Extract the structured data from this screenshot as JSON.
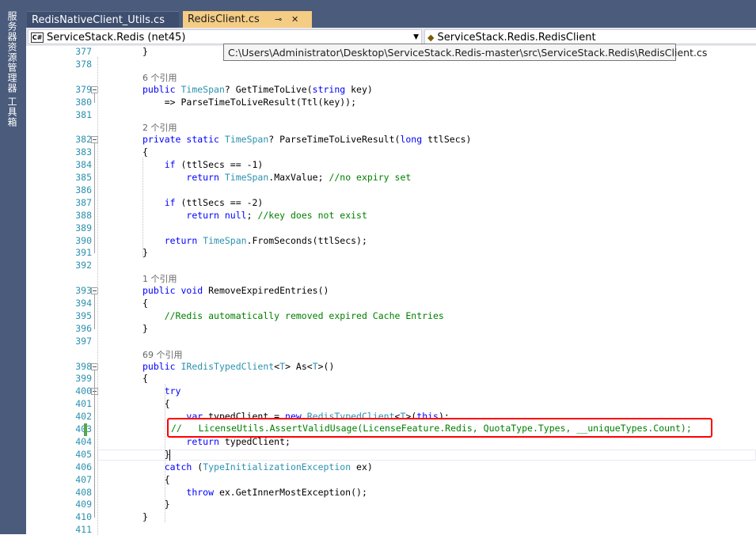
{
  "sidebar": {
    "items": [
      {
        "label": "服务器资源管理器"
      },
      {
        "label": "工具箱"
      }
    ]
  },
  "tabs": [
    {
      "label": "RedisNativeClient_Utils.cs",
      "active": false
    },
    {
      "label": "RedisClient.cs",
      "active": true
    }
  ],
  "tab_icons": {
    "pin": "⊸",
    "close": "✕"
  },
  "nav": {
    "project": "ServiceStack.Redis (net45)",
    "project_badge": "C#",
    "type": "ServiceStack.Redis.RedisClient",
    "dropdown_icon": "▼"
  },
  "tooltip": "C:\\Users\\Administrator\\Desktop\\ServiceStack.Redis-master\\src\\ServiceStack.Redis\\RedisClient.cs",
  "highlight_line": "//   LicenseUtils.AssertValidUsage(LicenseFeature.Redis, QuotaType.Types, __uniqueTypes.Count);",
  "lines": [
    {
      "n": "377",
      "code": "}"
    },
    {
      "n": "378",
      "code": ""
    },
    {
      "n": "",
      "code": "6 个引用"
    },
    {
      "n": "379",
      "code": "public TimeSpan? GetTimeToLive(string key)"
    },
    {
      "n": "380",
      "code": "    => ParseTimeToLiveResult(Ttl(key));"
    },
    {
      "n": "381",
      "code": ""
    },
    {
      "n": "",
      "code": "2 个引用"
    },
    {
      "n": "382",
      "code": "private static TimeSpan? ParseTimeToLiveResult(long ttlSecs)"
    },
    {
      "n": "383",
      "code": "{"
    },
    {
      "n": "384",
      "code": "    if (ttlSecs == -1)"
    },
    {
      "n": "385",
      "code": "        return TimeSpan.MaxValue; //no expiry set"
    },
    {
      "n": "386",
      "code": ""
    },
    {
      "n": "387",
      "code": "    if (ttlSecs == -2)"
    },
    {
      "n": "388",
      "code": "        return null; //key does not exist"
    },
    {
      "n": "389",
      "code": ""
    },
    {
      "n": "390",
      "code": "    return TimeSpan.FromSeconds(ttlSecs);"
    },
    {
      "n": "391",
      "code": "}"
    },
    {
      "n": "392",
      "code": ""
    },
    {
      "n": "",
      "code": "1 个引用"
    },
    {
      "n": "393",
      "code": "public void RemoveExpiredEntries()"
    },
    {
      "n": "394",
      "code": "{"
    },
    {
      "n": "395",
      "code": "    //Redis automatically removed expired Cache Entries"
    },
    {
      "n": "396",
      "code": "}"
    },
    {
      "n": "397",
      "code": ""
    },
    {
      "n": "",
      "code": "69 个引用"
    },
    {
      "n": "398",
      "code": "public IRedisTypedClient<T> As<T>()"
    },
    {
      "n": "399",
      "code": "{"
    },
    {
      "n": "400",
      "code": "    try"
    },
    {
      "n": "401",
      "code": "    {"
    },
    {
      "n": "402",
      "code": "        var typedClient = new RedisTypedClient<T>(this);"
    },
    {
      "n": "403",
      "code": ""
    },
    {
      "n": "404",
      "code": "        return typedClient;"
    },
    {
      "n": "405",
      "code": "    }"
    },
    {
      "n": "406",
      "code": "    catch (TypeInitializationException ex)"
    },
    {
      "n": "407",
      "code": "    {"
    },
    {
      "n": "408",
      "code": "        throw ex.GetInnerMostException();"
    },
    {
      "n": "409",
      "code": "    }"
    },
    {
      "n": "410",
      "code": "}"
    },
    {
      "n": "411",
      "code": ""
    }
  ]
}
